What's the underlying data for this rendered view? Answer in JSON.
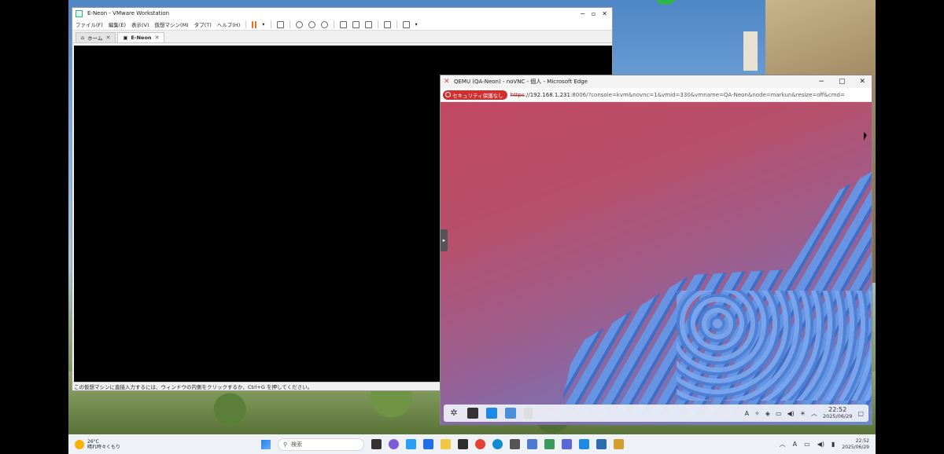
{
  "vmware": {
    "title": "E-Neon - VMware Workstation",
    "menu": [
      "ファイル(F)",
      "編集(E)",
      "表示(V)",
      "仮想マシン(M)",
      "タブ(T)",
      "ヘルプ(H)"
    ],
    "tabs": [
      {
        "label": "ホーム",
        "active": false
      },
      {
        "label": "E-Neon",
        "active": true
      }
    ],
    "status": "この仮想マシンに直接入力するには、ウィンドウの内側をクリックするか、Ctrl+G を押してください。"
  },
  "edge": {
    "title": "QEMU (QA-Neon) - noVNC - 個人 - Microsoft Edge",
    "security_badge": "セキュリティ保護なし",
    "url_scheme": "https",
    "url_host": "://192.168.1.231",
    "url_rest": ":8006/?console=kvm&novnc=1&vmid=330&vmname=QA-Neon&node=markun&resize=off&cmd="
  },
  "guest_panel": {
    "time": "22:52",
    "date": "2025/06/29",
    "tray_letter": "A"
  },
  "taskbar": {
    "temperature": "26°C",
    "weather": "晴れ時々くもり",
    "search_placeholder": "検索",
    "ime": "A",
    "time": "22:52",
    "date": "2025/06/29"
  }
}
